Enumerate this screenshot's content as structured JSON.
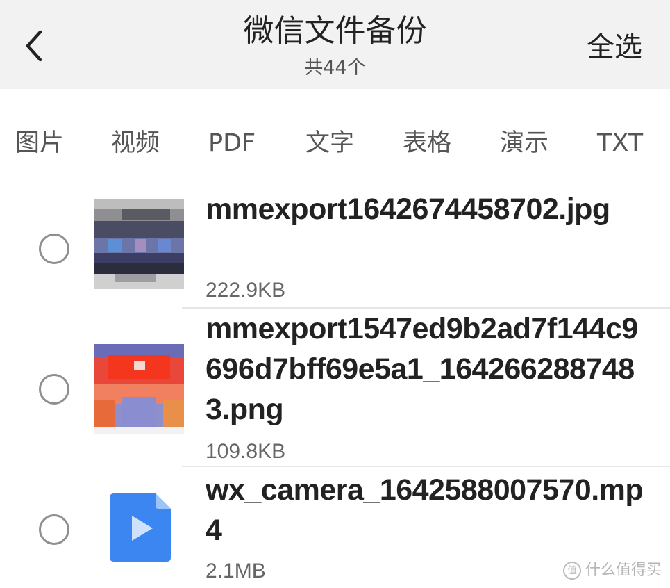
{
  "header": {
    "title": "微信文件备份",
    "subtitle": "共44个",
    "select_all": "全选",
    "back_icon": "chevron-left-icon"
  },
  "tabs": [
    {
      "label": "图片"
    },
    {
      "label": "视频"
    },
    {
      "label": "PDF"
    },
    {
      "label": "文字"
    },
    {
      "label": "表格"
    },
    {
      "label": "演示"
    },
    {
      "label": "TXT"
    }
  ],
  "files": [
    {
      "name": "mmexport1642674458702.jpg",
      "size": "222.9KB",
      "thumb": "image-thumbnail",
      "selected": false
    },
    {
      "name": "mmexport1547ed9b2ad7f144c9696d7bff69e5a1_1642662887483.png",
      "size": "109.8KB",
      "thumb": "image-thumbnail",
      "selected": false
    },
    {
      "name": "wx_camera_1642588007570.mp4",
      "size": "2.1MB",
      "thumb": "video-file-icon",
      "selected": false
    }
  ],
  "watermark": {
    "text": "什么值得买"
  },
  "colors": {
    "header_bg": "#f2f2f2",
    "video_icon": "#3b86f0",
    "radio_border": "#8f8f8f"
  }
}
